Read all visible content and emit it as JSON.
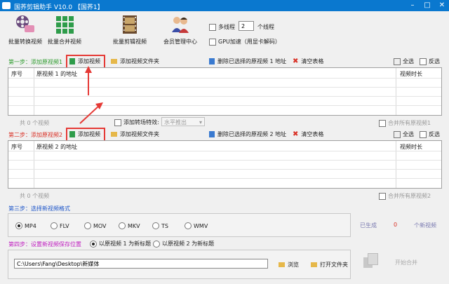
{
  "title": "国荞剪辑助手 V10.0   【国荞1】",
  "toolbar": [
    {
      "label": "批量转换视频"
    },
    {
      "label": "批量合并视频"
    },
    {
      "label": "批量剪辑视频"
    },
    {
      "label": "会员管理中心"
    }
  ],
  "options": {
    "multithread": "多线程",
    "thread_count": "2",
    "thread_unit": "个线程",
    "gpu": "GPU加速（用显卡解码）"
  },
  "step1": {
    "title": "第一步：添加原视频1",
    "add_video": "添加视频",
    "add_folder": "添加视频文件夹",
    "delete_selected": "删除已选择的原视频 1 地址",
    "clear": "清空表格",
    "select_all": "全选",
    "invert": "反选",
    "col_no": "序号",
    "col_path": "原视频 1 的地址",
    "col_dur": "视频时长",
    "count": "共 0 个视频",
    "merge_all": "合并所有原视频1"
  },
  "transition": {
    "label": "添加转场特效:",
    "value": "水平推出"
  },
  "step2": {
    "title": "第二步：添加原视频2",
    "add_video": "添加视频",
    "add_folder": "添加视频文件夹",
    "delete_selected": "删除已选择的原视频 2 地址",
    "clear": "清空表格",
    "select_all": "全选",
    "invert": "反选",
    "col_no": "序号",
    "col_path": "原视频 2 的地址",
    "col_dur": "视频时长",
    "count": "共 0 个视频",
    "merge_all": "合并所有原视频2"
  },
  "step3": {
    "title": "第三步：选择新视频格式",
    "formats": [
      "MP4",
      "FLV",
      "MOV",
      "MKV",
      "TS",
      "WMV"
    ],
    "selected": "MP4",
    "generated_label": "已生成",
    "generated_count": "0",
    "generated_unit": "个新视频"
  },
  "step4": {
    "title": "第四步：设置新视频保存位置",
    "opt1": "以原视频 1 为新标题",
    "opt2": "以原视频 2 为新标题",
    "path": "C:\\Users\\Fang\\Desktop\\新媒体",
    "browse": "浏览",
    "open_folder": "打开文件夹",
    "start": "开始合并"
  }
}
